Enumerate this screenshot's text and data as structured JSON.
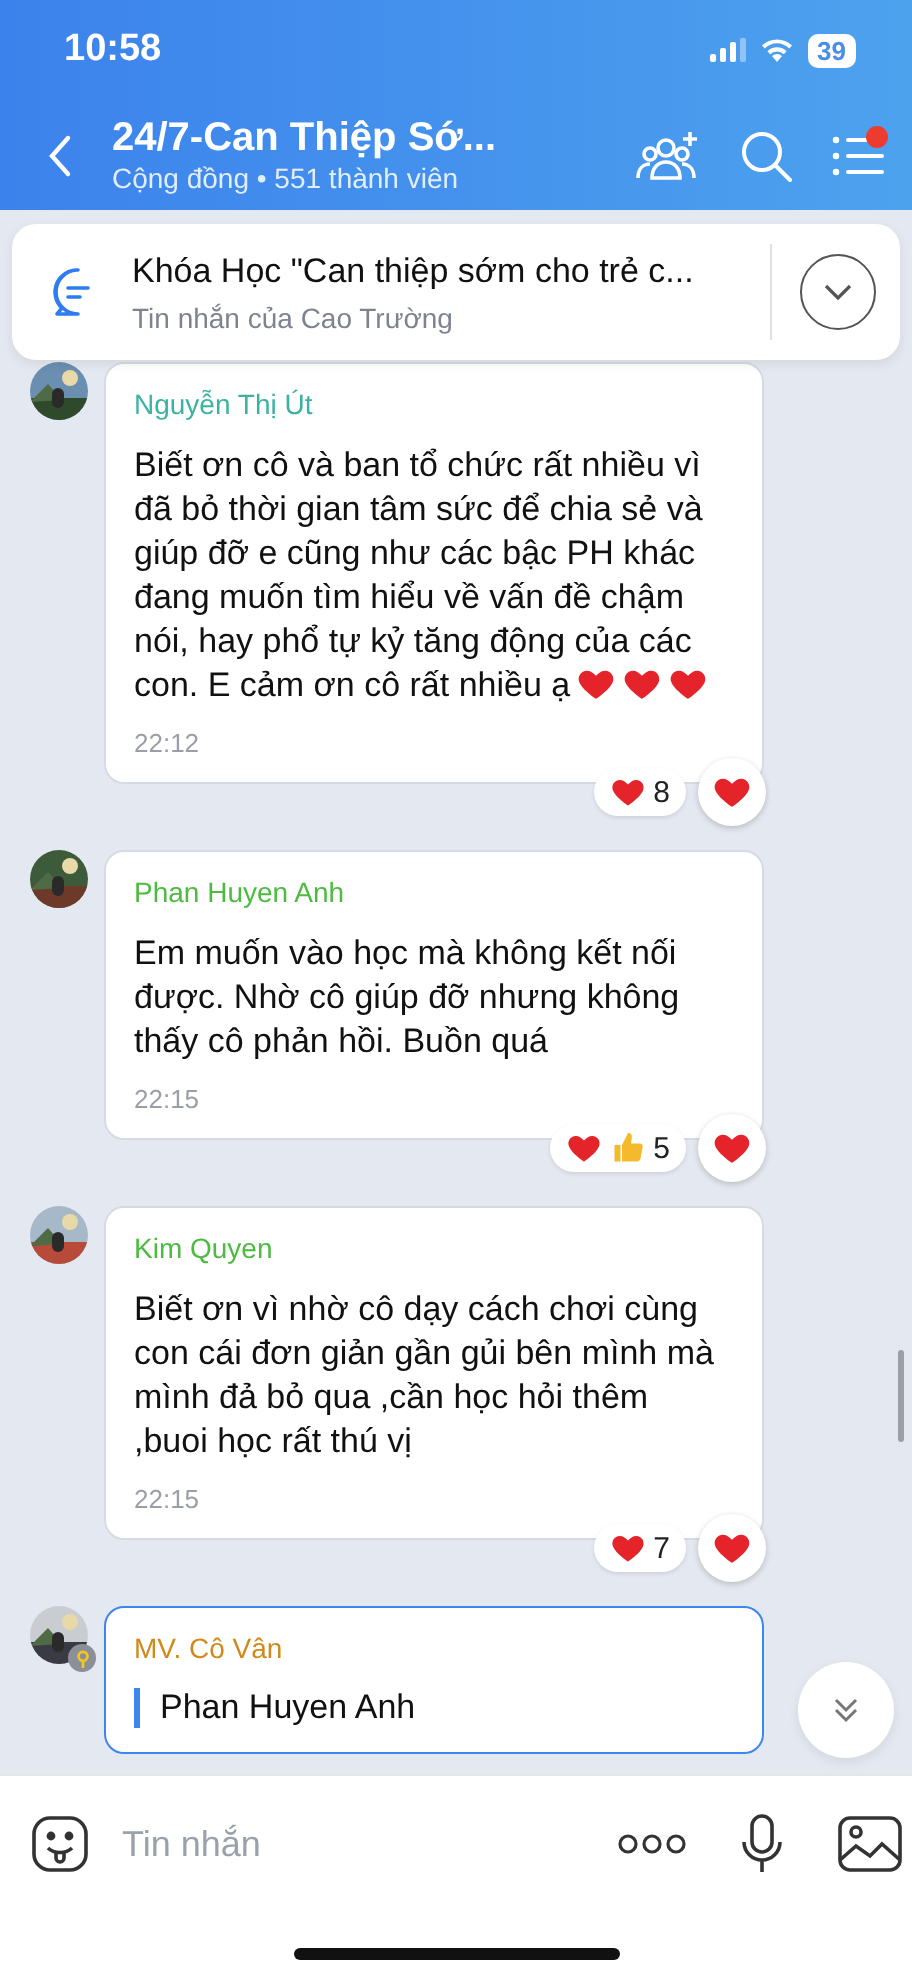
{
  "status_bar": {
    "time": "10:58",
    "battery": "39"
  },
  "header": {
    "title": "24/7-Can Thiệp Sớ...",
    "subtitle": "Cộng đồng • 551 thành viên",
    "menu_badge": true
  },
  "pinned": {
    "title": "Khóa Học \"Can thiệp sớm cho trẻ c...",
    "subtitle": "Tin nhắn của Cao Trường"
  },
  "messages": [
    {
      "sender": "Nguyễn Thị Út",
      "color": "#3bb3a3",
      "text": "Biết ơn cô và ban tổ chức rất nhiều vì đã bỏ thời gian tâm sức để chia sẻ và giúp đỡ e cũng như các bậc PH khác đang muốn tìm hiểu về vấn đề chậm nói, hay phổ tự kỷ tăng động của các con. E cảm ơn cô rất nhiều ạ",
      "trailing_icons": [
        {
          "kind": "heart"
        },
        {
          "kind": "heart"
        },
        {
          "kind": "heart"
        }
      ],
      "time": "22:12",
      "reactions": [
        {
          "kind": "heart"
        }
      ],
      "reaction_count": "8",
      "highlighted": false
    },
    {
      "sender": "Phan Huyen Anh",
      "color": "#4cbb3f",
      "text": "Em muốn vào học mà không kết nối được. Nhờ cô giúp đỡ nhưng không thấy cô phản hồi. Buồn quá",
      "time": "22:15",
      "reactions": [
        {
          "kind": "heart"
        },
        {
          "kind": "thumbs_up"
        }
      ],
      "reaction_count": "5",
      "highlighted": false
    },
    {
      "sender": "Kim Quyen",
      "color": "#4cbb3f",
      "text": "Biết ơn vì nhờ cô dạy cách chơi cùng con cái đơn giản gần gủi bên mình mà mình đả bỏ qua ,cần học hỏi thêm  ,buoi học rất thú vị",
      "time": "22:15",
      "reactions": [
        {
          "kind": "heart"
        }
      ],
      "reaction_count": "7",
      "highlighted": false
    },
    {
      "sender": "MV. Cô Vân",
      "color": "#d08a1c",
      "quote": "Phan Huyen Anh",
      "highlighted": true,
      "key_badge": true
    }
  ],
  "composer": {
    "placeholder": "Tin nhắn"
  }
}
